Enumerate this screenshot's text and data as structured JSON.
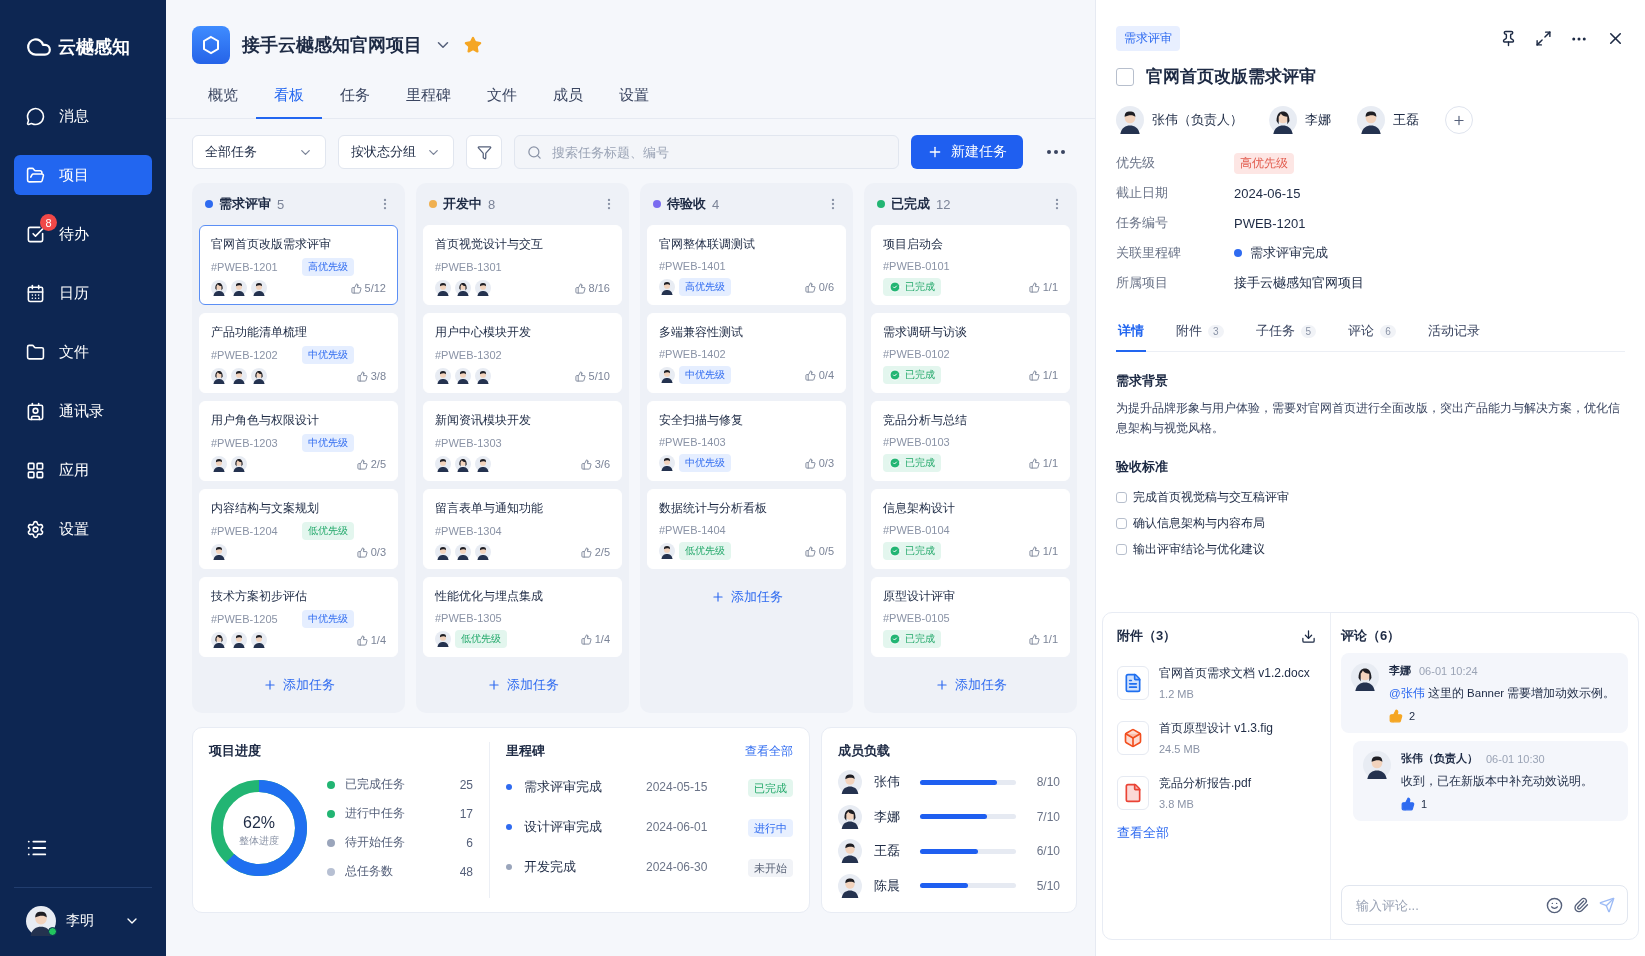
{
  "sidebar": {
    "brand": "云樾感知",
    "items": [
      {
        "label": "消息",
        "selected": false
      },
      {
        "label": "项目",
        "selected": true
      },
      {
        "label": "待办",
        "selected": false,
        "badge": "8"
      },
      {
        "label": "日历",
        "selected": false
      },
      {
        "label": "文件",
        "selected": false
      },
      {
        "label": "通讯录",
        "selected": false
      },
      {
        "label": "应用",
        "selected": false
      },
      {
        "label": "设置",
        "selected": false
      }
    ],
    "user": {
      "name": "李明",
      "online": true
    }
  },
  "header": {
    "project": "接手云樾感知官网项目",
    "starred": true,
    "tabs": [
      {
        "label": "概览",
        "selected": false
      },
      {
        "label": "看板",
        "selected": true
      },
      {
        "label": "任务",
        "selected": false
      },
      {
        "label": "里程碑",
        "selected": false
      },
      {
        "label": "文件",
        "selected": false
      },
      {
        "label": "成员",
        "selected": false
      },
      {
        "label": "设置",
        "selected": false
      }
    ]
  },
  "toolbar": {
    "filter": "全部任务",
    "group": "按状态分组",
    "search": {
      "placeholder": "搜索任务标题、编号"
    },
    "new_button": "新建任务"
  },
  "columns": [
    {
      "title": "需求评审",
      "count": "5",
      "color": "#2f6bf0",
      "add": "添加任务",
      "cards": [
        {
          "title": "官网首页改版需求评审",
          "id": "#PWEB-1201",
          "meta_tag": {
            "text": "高优先级",
            "kind": "blue"
          },
          "avatars": [
            {
              "kind": "woman"
            },
            {
              "kind": "man"
            },
            {
              "kind": "man"
            }
          ],
          "progress": "5/12",
          "selected": true
        },
        {
          "title": "产品功能清单梳理",
          "id": "#PWEB-1202",
          "meta_tag": {
            "text": "中优先级",
            "kind": "blue"
          },
          "avatars": [
            {
              "kind": "woman"
            },
            {
              "kind": "man"
            },
            {
              "kind": "woman"
            }
          ],
          "progress": "3/8",
          "selected": false
        },
        {
          "title": "用户角色与权限设计",
          "id": "#PWEB-1203",
          "meta_tag": {
            "text": "中优先级",
            "kind": "blue"
          },
          "avatars": [
            {
              "kind": "man"
            },
            {
              "kind": "woman"
            }
          ],
          "progress": "2/5",
          "selected": false
        },
        {
          "title": "内容结构与文案规划",
          "id": "#PWEB-1204",
          "meta_tag": {
            "text": "低优先级",
            "kind": "green"
          },
          "avatars": [
            {
              "kind": "man"
            }
          ],
          "progress": "0/3",
          "selected": false
        },
        {
          "title": "技术方案初步评估",
          "id": "#PWEB-1205",
          "meta_tag": {
            "text": "中优先级",
            "kind": "blue"
          },
          "avatars": [
            {
              "kind": "woman"
            },
            {
              "kind": "man"
            },
            {
              "kind": "man"
            }
          ],
          "progress": "1/4",
          "selected": false
        }
      ]
    },
    {
      "title": "开发中",
      "count": "8",
      "color": "#f0b050",
      "add": "添加任务",
      "cards": [
        {
          "title": "首页视觉设计与交互",
          "id": "#PWEB-1301",
          "avatars": [
            {
              "kind": "man"
            },
            {
              "kind": "woman"
            },
            {
              "kind": "man"
            }
          ],
          "progress": "8/16",
          "selected": false
        },
        {
          "title": "用户中心模块开发",
          "id": "#PWEB-1302",
          "avatars": [
            {
              "kind": "man"
            },
            {
              "kind": "man"
            },
            {
              "kind": "man"
            }
          ],
          "progress": "5/10",
          "selected": false
        },
        {
          "title": "新闻资讯模块开发",
          "id": "#PWEB-1303",
          "avatars": [
            {
              "kind": "man"
            },
            {
              "kind": "woman"
            },
            {
              "kind": "man"
            }
          ],
          "progress": "3/6",
          "selected": false
        },
        {
          "title": "留言表单与通知功能",
          "id": "#PWEB-1304",
          "avatars": [
            {
              "kind": "man"
            },
            {
              "kind": "man"
            },
            {
              "kind": "man"
            }
          ],
          "progress": "2/5",
          "selected": false
        },
        {
          "title": "性能优化与埋点集成",
          "id": "#PWEB-1305",
          "footer_tag": {
            "text": "低优先级",
            "kind": "green"
          },
          "avatars": [
            {
              "kind": "man"
            }
          ],
          "progress": "1/4",
          "selected": false
        }
      ]
    },
    {
      "title": "待验收",
      "count": "4",
      "color": "#7b6cf0",
      "add": "添加任务",
      "cards": [
        {
          "title": "官网整体联调测试",
          "id": "#PWEB-1401",
          "footer_tag": {
            "text": "高优先级",
            "kind": "blue"
          },
          "avatars": [
            {
              "kind": "man"
            }
          ],
          "progress": "0/6",
          "selected": false
        },
        {
          "title": "多端兼容性测试",
          "id": "#PWEB-1402",
          "footer_tag": {
            "text": "中优先级",
            "kind": "blue"
          },
          "avatars": [
            {
              "kind": "man"
            }
          ],
          "progress": "0/4",
          "selected": false
        },
        {
          "title": "安全扫描与修复",
          "id": "#PWEB-1403",
          "footer_tag": {
            "text": "中优先级",
            "kind": "blue"
          },
          "avatars": [
            {
              "kind": "man"
            }
          ],
          "progress": "0/3",
          "selected": false
        },
        {
          "title": "数据统计与分析看板",
          "id": "#PWEB-1404",
          "footer_tag": {
            "text": "低优先级",
            "kind": "green"
          },
          "avatars": [
            {
              "kind": "man"
            }
          ],
          "progress": "0/5",
          "selected": false
        }
      ]
    },
    {
      "title": "已完成",
      "count": "12",
      "color": "#22b573",
      "add": "添加任务",
      "cards": [
        {
          "title": "项目启动会",
          "id": "#PWEB-0101",
          "footer_tag": {
            "text": "已完成",
            "kind": "done"
          },
          "progress": "1/1",
          "selected": false
        },
        {
          "title": "需求调研与访谈",
          "id": "#PWEB-0102",
          "footer_tag": {
            "text": "已完成",
            "kind": "done"
          },
          "progress": "1/1",
          "selected": false
        },
        {
          "title": "竞品分析与总结",
          "id": "#PWEB-0103",
          "footer_tag": {
            "text": "已完成",
            "kind": "done"
          },
          "progress": "1/1",
          "selected": false
        },
        {
          "title": "信息架构设计",
          "id": "#PWEB-0104",
          "footer_tag": {
            "text": "已完成",
            "kind": "done"
          },
          "progress": "1/1",
          "selected": false
        },
        {
          "title": "原型设计评审",
          "id": "#PWEB-0105",
          "footer_tag": {
            "text": "已完成",
            "kind": "done"
          },
          "progress": "1/1",
          "selected": false
        }
      ]
    }
  ],
  "progress": {
    "title": "项目进度",
    "level": 0.62,
    "percent": "62%",
    "caption": "整体进度",
    "legend": [
      {
        "label": "已完成任务",
        "value": "25",
        "color": "#22b573"
      },
      {
        "label": "进行中任务",
        "value": "17",
        "color": "#22b573"
      },
      {
        "label": "待开始任务",
        "value": "6",
        "color": "#9aa5bb"
      },
      {
        "label": "总任务数",
        "value": "48",
        "color": "#b7c0d3"
      }
    ]
  },
  "milestones": {
    "title": "里程碑",
    "link": "查看全部",
    "items": [
      {
        "name": "需求评审完成",
        "date": "2024-05-15",
        "status": "已完成",
        "kind": "done"
      },
      {
        "name": "设计评审完成",
        "date": "2024-06-01",
        "status": "进行中",
        "kind": "active"
      },
      {
        "name": "开发完成",
        "date": "2024-06-30",
        "status": "未开始",
        "kind": "todo"
      }
    ]
  },
  "workload": {
    "title": "成员负载",
    "members": [
      {
        "name": "张伟",
        "kind": "man",
        "level": 0.8,
        "reading": "8/10"
      },
      {
        "name": "李娜",
        "kind": "woman",
        "level": 0.7,
        "reading": "7/10"
      },
      {
        "name": "王磊",
        "kind": "man",
        "level": 0.6,
        "reading": "6/10"
      },
      {
        "name": "陈晨",
        "kind": "man",
        "level": 0.5,
        "reading": "5/10"
      }
    ]
  },
  "detail": {
    "status_tag": "需求评审",
    "title": "官网首页改版需求评审",
    "done": false,
    "people": [
      {
        "name": "张伟（负责人）",
        "kind": "man"
      },
      {
        "name": "李娜",
        "kind": "woman"
      },
      {
        "name": "王磊",
        "kind": "man"
      }
    ],
    "fields": [
      {
        "label": "优先级",
        "value": "高优先级",
        "kind": "tag"
      },
      {
        "label": "截止日期",
        "value": "2024-06-15",
        "kind": "text"
      },
      {
        "label": "任务编号",
        "value": "PWEB-1201",
        "kind": "text"
      },
      {
        "label": "关联里程碑",
        "value": "需求评审完成",
        "kind": "milestone"
      },
      {
        "label": "所属项目",
        "value": "接手云樾感知官网项目",
        "kind": "text"
      }
    ],
    "tabs": [
      {
        "label": "详情",
        "selected": true
      },
      {
        "label": "附件",
        "count": "3",
        "selected": false
      },
      {
        "label": "子任务",
        "count": "5",
        "selected": false
      },
      {
        "label": "评论",
        "count": "6",
        "selected": false
      },
      {
        "label": "活动记录",
        "selected": false
      }
    ],
    "background": {
      "heading": "需求背景",
      "text": "为提升品牌形象与用户体验，需要对官网首页进行全面改版，突出产品能力与解决方案，优化信息架构与视觉风格。"
    },
    "criteria": {
      "heading": "验收标准",
      "items": [
        {
          "text": "完成首页视觉稿与交互稿评审",
          "checked": false
        },
        {
          "text": "确认信息架构与内容布局",
          "checked": false
        },
        {
          "text": "输出评审结论与优化建议",
          "checked": false
        }
      ]
    },
    "attachments": {
      "title": "附件（3）",
      "link": "查看全部",
      "files": [
        {
          "name": "官网首页需求文档 v1.2.docx",
          "size": "1.2 MB"
        },
        {
          "name": "首页原型设计 v1.3.fig",
          "size": "24.5 MB"
        },
        {
          "name": "竞品分析报告.pdf",
          "size": "3.8 MB"
        }
      ]
    },
    "comments": {
      "title": "评论（6）",
      "placeholder": "输入评论...",
      "items": [
        {
          "author": "李娜",
          "kind": "woman",
          "time": "06-01 10:24",
          "mention": "@张伟",
          "text": "这里的 Banner 需要增加动效示例。",
          "like": {
            "count": "2",
            "color": "#f5a623"
          },
          "reply": false
        },
        {
          "author": "张伟（负责人）",
          "kind": "man",
          "time": "06-01 10:30",
          "text": "收到，已在新版本中补充动效说明。",
          "like": {
            "count": "1",
            "color": "#2f6bf0"
          },
          "reply": true
        }
      ]
    }
  }
}
